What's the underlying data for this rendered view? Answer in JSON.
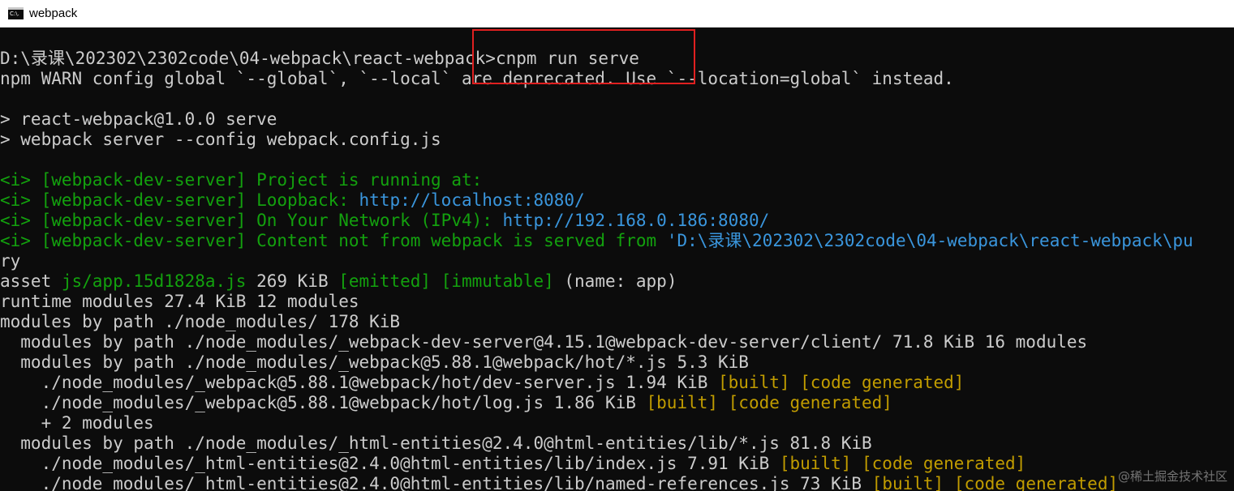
{
  "window": {
    "title": "webpack",
    "icon_text": "C:\\."
  },
  "console": {
    "lines": [
      "D:\\录课\\202302\\2302code\\04-webpack\\react-webpack>cnpm run serve",
      "npm WARN config global `--global`, `--local` are deprecated. Use `--location=global` instead.",
      "",
      "> react-webpack@1.0.0 serve",
      "> webpack server --config webpack.config.js",
      "",
      {
        "tag": "<i> ",
        "source": "[webpack-dev-server]",
        "message": " Project is running at:"
      },
      {
        "tag": "<i> ",
        "source": "[webpack-dev-server]",
        "message": " Loopback: ",
        "url": "http://localhost:8080/"
      },
      {
        "tag": "<i> ",
        "source": "[webpack-dev-server]",
        "message": " On Your Network (IPv4): ",
        "url": "http://192.168.0.186:8080/"
      },
      {
        "tag": "<i> ",
        "source": "[webpack-dev-server]",
        "message": " Content not from webpack is served from ",
        "url": "'D:\\录课\\202302\\2302code\\04-webpack\\react-webpack\\pu"
      },
      "ry",
      {
        "prefix": "asset ",
        "file": "js/app.15d1828a.js",
        "size": " 269 KiB ",
        "flags": "[emitted] [immutable]",
        "suffix": " (name: app)"
      },
      "runtime modules 27.4 KiB 12 modules",
      "modules by path ./node_modules/ 178 KiB",
      "  modules by path ./node_modules/_webpack-dev-server@4.15.1@webpack-dev-server/client/ 71.8 KiB 16 modules",
      "  modules by path ./node_modules/_webpack@5.88.1@webpack/hot/*.js 5.3 KiB",
      {
        "prefix": "    ./node_modules/_webpack@5.88.1@webpack/hot/dev-server.js 1.94 KiB ",
        "flags": "[built] [code generated]"
      },
      {
        "prefix": "    ./node_modules/_webpack@5.88.1@webpack/hot/log.js 1.86 KiB ",
        "flags": "[built] [code generated]"
      },
      "    + 2 modules",
      "  modules by path ./node_modules/_html-entities@2.4.0@html-entities/lib/*.js 81.8 KiB",
      {
        "prefix": "    ./node_modules/_html-entities@2.4.0@html-entities/lib/index.js 7.91 KiB ",
        "flags": "[built] [code generated]"
      },
      {
        "prefix": "    ./node_modules/_html-entities@2.4.0@html-entities/lib/named-references.js 73 KiB ",
        "flags": "[built] [code generated]"
      }
    ]
  },
  "watermark": "@稀土掘金技术社区",
  "colors": {
    "background": "#0c0c0c",
    "text": "#cccccc",
    "green": "#13a10e",
    "cyan": "#3a96dd",
    "yellow": "#c19c00",
    "highlight": "#e02020"
  }
}
